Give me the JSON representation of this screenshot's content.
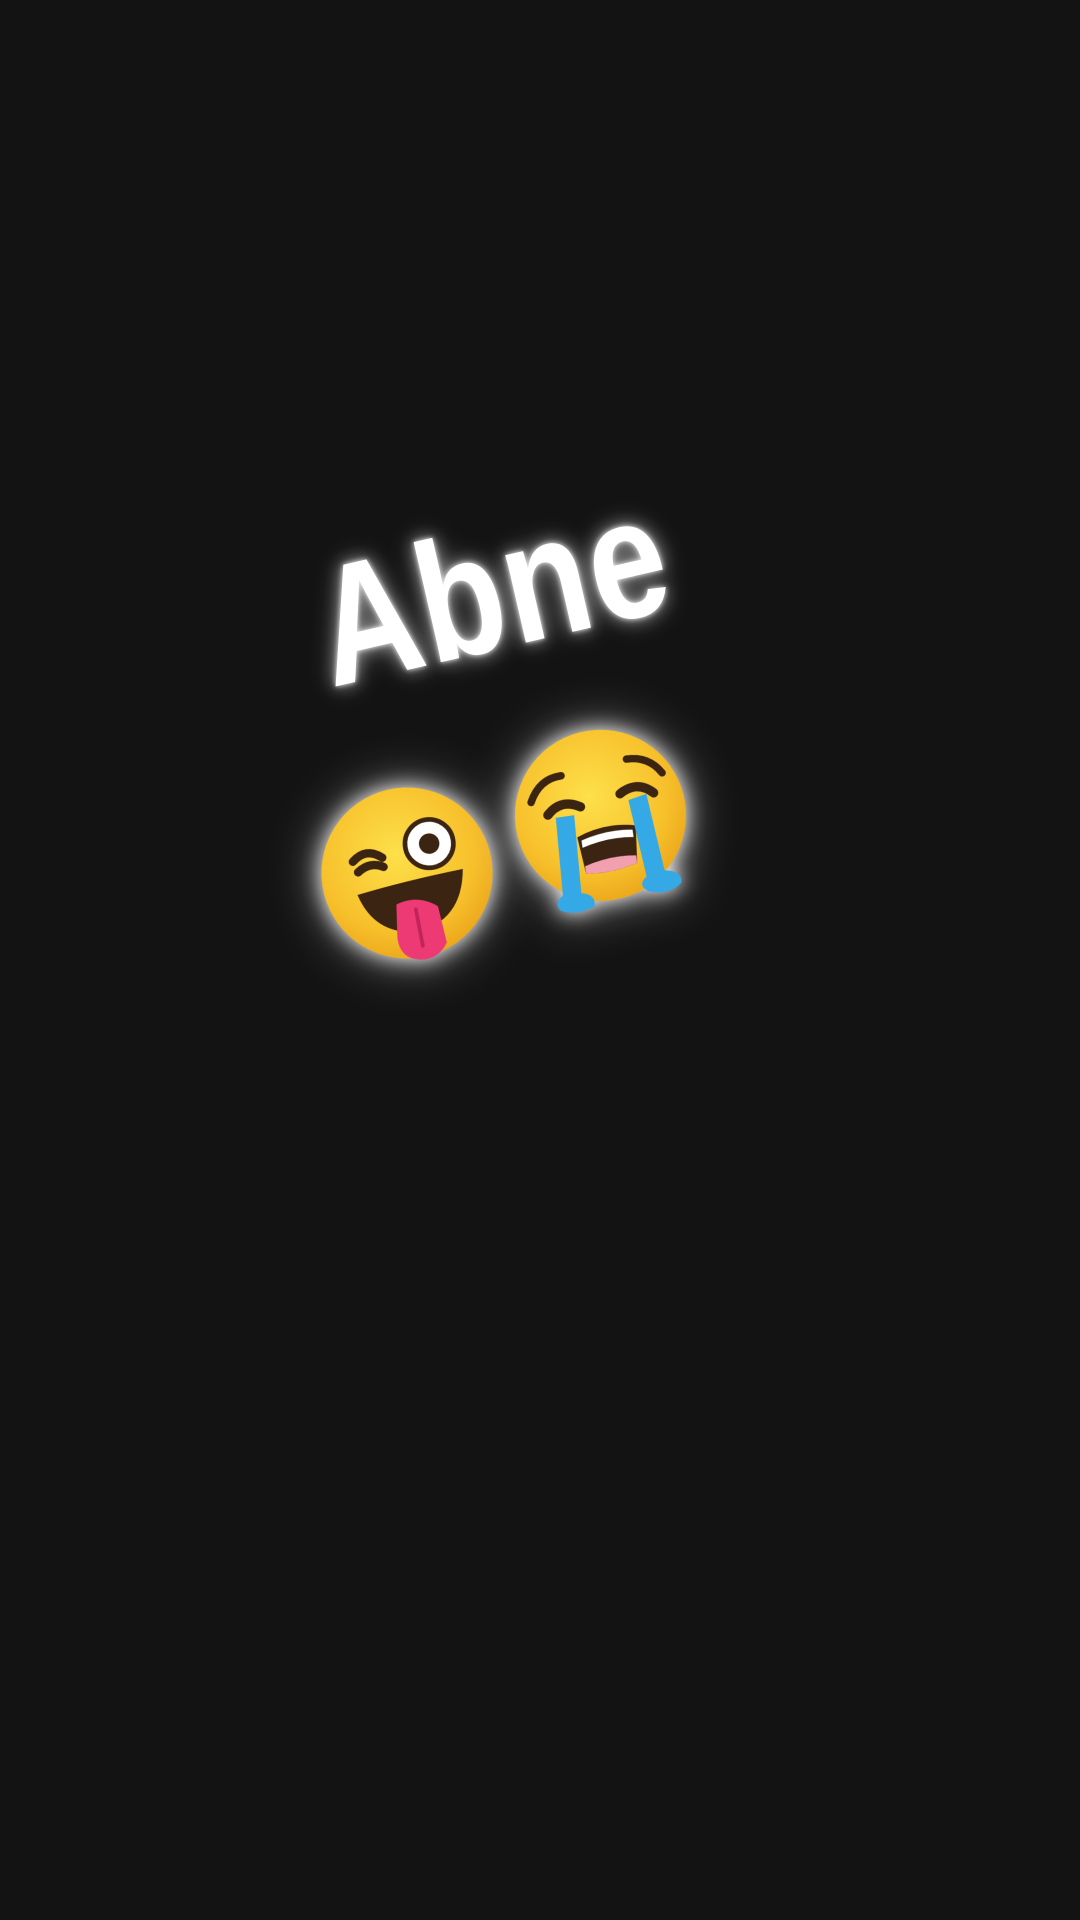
{
  "caption": {
    "text": "Abne"
  },
  "emojis": [
    {
      "name": "winking-face-with-tongue-icon",
      "char": "😜"
    },
    {
      "name": "loudly-crying-face-icon",
      "char": "😭"
    }
  ],
  "colors": {
    "background": "#131313",
    "text": "#ffffff",
    "glow": "#ffffff",
    "face": "#f8c231",
    "tongue": "#ee3a74",
    "tears": "#35a8e6"
  }
}
